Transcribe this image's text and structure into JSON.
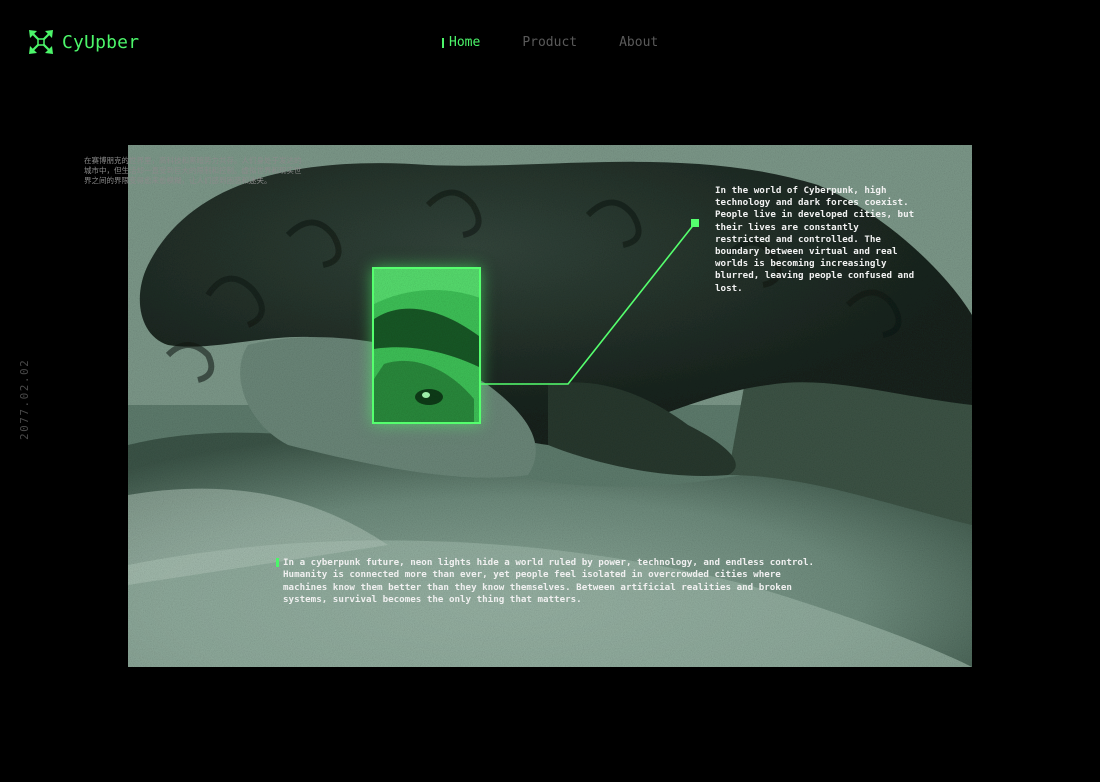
{
  "brand": {
    "name": "CyUpber",
    "logo_icon": "crossed-arrows-icon",
    "accent": "#4cf56a"
  },
  "nav": {
    "items": [
      {
        "label": "Home",
        "active": true
      },
      {
        "label": "Product",
        "active": false
      },
      {
        "label": "About",
        "active": false
      }
    ]
  },
  "side": {
    "date": "2077.02.02"
  },
  "intro_cn": "在赛博朋克的世界里，高科技和黑暗势力共存。人们身处于发达的城市中，但生活却一直受到巨大的限制和控制。虚拟世界和现实世界之间的界限变得愈来愈模糊，让人们感到困惑和迷失。",
  "callout": "In the world of Cyberpunk, high technology and dark forces coexist. People live in developed cities, but their lives are constantly restricted and controlled. The boundary between virtual and real worlds is becoming increasingly blurred, leaving people confused and lost.",
  "footer_text": "In a cyberpunk future, neon lights hide a world ruled by power, technology, and endless control. Humanity is connected more than ever, yet people feel isolated in overcrowded cities where machines know them better than they know themselves. Between artificial realities and broken systems, survival becomes the only thing that matters.",
  "colors": {
    "background": "#000000",
    "photo_dark": "#1c2a24",
    "photo_light": "#a9c2b4",
    "neon": "#55ff6e"
  }
}
